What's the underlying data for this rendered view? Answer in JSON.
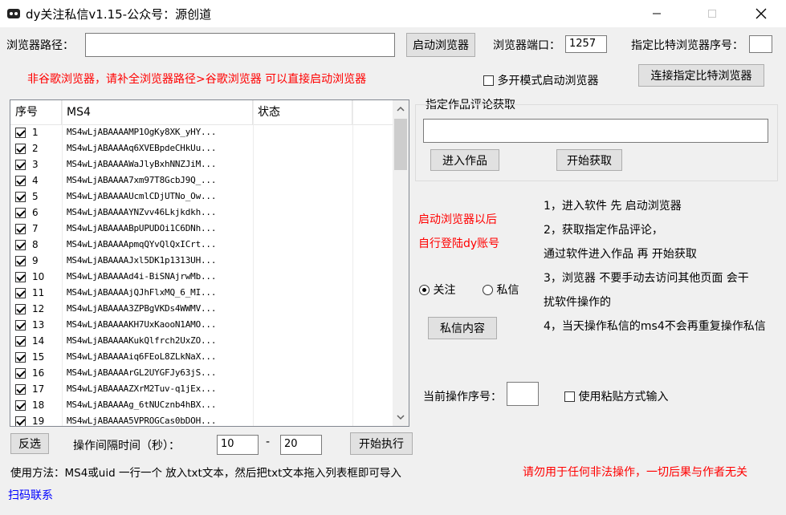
{
  "window": {
    "title": "dy关注私信v1.15-公众号：源创道"
  },
  "browser_path": {
    "label": "浏览器路径：",
    "value": ""
  },
  "launch_button": "启动浏览器",
  "port": {
    "label": "浏览器端口：",
    "value": "1257"
  },
  "bitbrowser": {
    "label": "指定比特浏览器序号：",
    "value": "",
    "connect_button": "连接指定比特浏览器"
  },
  "warning_text": "非谷歌浏览器，请补全浏览器路径>谷歌浏览器 可以直接启动浏览器",
  "multi_mode": {
    "label": "多开模式启动浏览器",
    "checked": false
  },
  "list": {
    "columns": [
      "序号",
      "MS4",
      "状态"
    ],
    "rows": [
      {
        "n": "1",
        "ms4": "MS4wLjABAAAAMP1OgKy8XK_yHY..."
      },
      {
        "n": "2",
        "ms4": "MS4wLjABAAAAq6XVEBpdeCHkUu..."
      },
      {
        "n": "3",
        "ms4": "MS4wLjABAAAAWaJlyBxhNNZJiM..."
      },
      {
        "n": "4",
        "ms4": "MS4wLjABAAAA7xm97T8GcbJ9Q_..."
      },
      {
        "n": "5",
        "ms4": "MS4wLjABAAAAUcmlCDjUTNo_Ow..."
      },
      {
        "n": "6",
        "ms4": "MS4wLjABAAAAYNZvv46Lkjkdkh..."
      },
      {
        "n": "7",
        "ms4": "MS4wLjABAAAABpUPUDOi1C6DNh..."
      },
      {
        "n": "8",
        "ms4": "MS4wLjABAAAApmqQYvQlQxICrt..."
      },
      {
        "n": "9",
        "ms4": "MS4wLjABAAAAJxl5DK1p1313UH..."
      },
      {
        "n": "10",
        "ms4": "MS4wLjABAAAAd4i-BiSNAjrwMb..."
      },
      {
        "n": "11",
        "ms4": "MS4wLjABAAAAjQJhFlxMQ_6_MI..."
      },
      {
        "n": "12",
        "ms4": "MS4wLjABAAAA3ZPBgVKDs4WWMV..."
      },
      {
        "n": "13",
        "ms4": "MS4wLjABAAAAKH7UxKaooN1AMO..."
      },
      {
        "n": "14",
        "ms4": "MS4wLjABAAAAKukQlfrch2UxZO..."
      },
      {
        "n": "15",
        "ms4": "MS4wLjABAAAAiq6FEoL8ZLkNaX..."
      },
      {
        "n": "16",
        "ms4": "MS4wLjABAAAArGL2UYGFJy63jS..."
      },
      {
        "n": "17",
        "ms4": "MS4wLjABAAAAZXrM2Tuv-q1jEx..."
      },
      {
        "n": "18",
        "ms4": "MS4wLjABAAAAg_6tNUCznb4hBX..."
      },
      {
        "n": "19",
        "ms4": "MS4wLjABAAAA5VPROGCas0bDOH..."
      }
    ]
  },
  "comment_group": {
    "title": "指定作品评论获取",
    "input_value": "",
    "enter_button": "进入作品",
    "start_button": "开始获取"
  },
  "login_hint": {
    "line1": "启动浏览器以后",
    "line2": "自行登陆dy账号"
  },
  "mode": {
    "follow_label": "关注",
    "dm_label": "私信",
    "selected": "follow"
  },
  "dm_content_button": "私信内容",
  "instructions": {
    "line1": "1，进入软件 先 启动浏览器",
    "line2": "2，获取指定作品评论，",
    "line3": "通过软件进入作品 再 开始获取",
    "line4": "3，浏览器 不要手动去访问其他页面 会干",
    "line5": "扰软件操作的",
    "line6": "4，当天操作私信的ms4不会再重复操作私信"
  },
  "current_index": {
    "label": "当前操作序号：",
    "value": ""
  },
  "paste_mode": {
    "label": "使用粘贴方式输入",
    "checked": false
  },
  "invert_button": "反选",
  "interval": {
    "label": "操作间隔时间（秒）：",
    "from": "10",
    "separator": "-",
    "to": "20"
  },
  "start_exec_button": "开始执行",
  "usage_text": "使用方法：MS4或uid 一行一个 放入txt文本，然后把txt文本拖入列表框即可导入",
  "disclaimer": "请勿用于任何非法操作，一切后果与作者无关",
  "contact_link": "扫码联系",
  "colors": {
    "warning": "#ff0000",
    "link": "#0000ff"
  }
}
